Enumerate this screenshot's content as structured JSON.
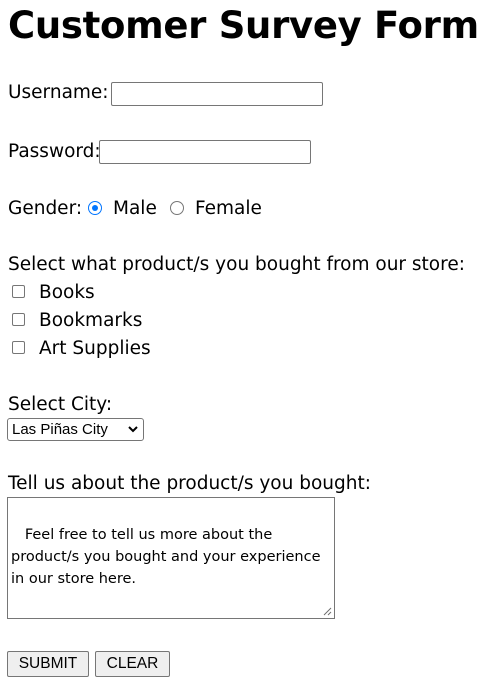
{
  "form": {
    "title": "Customer Survey Form",
    "username_label": "Username:",
    "username_value": "",
    "password_label": "Password:",
    "password_value": "",
    "gender_label": "Gender:",
    "gender_options": [
      "Male",
      "Female"
    ],
    "gender_selected": "Male",
    "products_label": "Select what product/s you bought from our store:",
    "products": [
      {
        "label": "Books",
        "checked": false
      },
      {
        "label": "Bookmarks",
        "checked": false
      },
      {
        "label": "Art Supplies",
        "checked": false
      }
    ],
    "city_label": "Select City:",
    "city_selected": "Las Piñas City",
    "feedback_label": "Tell us about the product/s you bought:",
    "feedback_value": " Feel free to tell us more about the product/s you bought and your experience in our store here.",
    "submit_label": "SUBMIT",
    "clear_label": "CLEAR"
  },
  "colors": {
    "accent": "#0075ff",
    "border": "#767676",
    "button_bg": "#efefef"
  }
}
